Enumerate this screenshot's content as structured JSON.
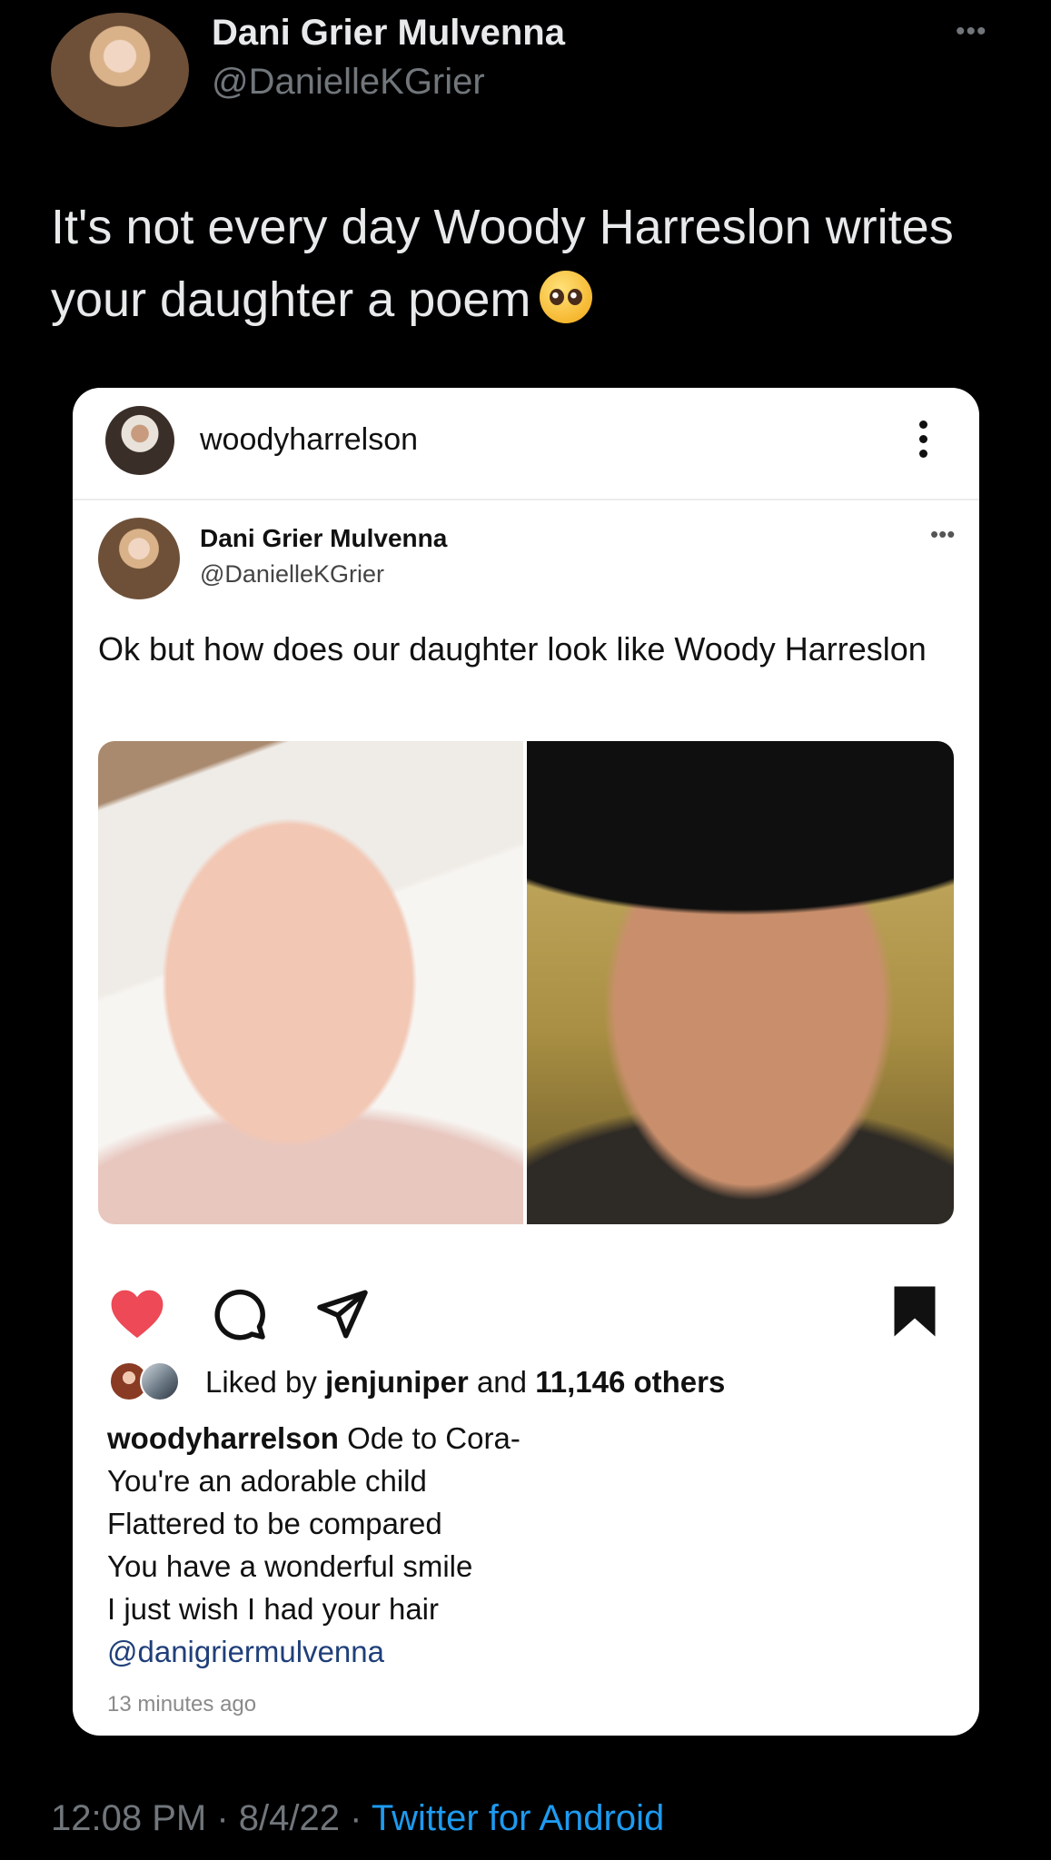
{
  "tweet": {
    "author_name": "Dani Grier Mulvenna",
    "author_handle": "@DanielleKGrier",
    "more_label": "•••",
    "text": "It's not every day Woody Harreslon writes your daughter a poem",
    "emoji": "pleading-face-emoji",
    "time": "12:08 PM",
    "date": "8/4/22",
    "separator": "·",
    "source": "Twitter for Android"
  },
  "instagram_post": {
    "username": "woodyharrelson",
    "embedded_tweet": {
      "author_name": "Dani Grier Mulvenna",
      "author_handle": "@DanielleKGrier",
      "more_label": "•••",
      "text": "Ok but how does our daughter look like Woody Harreslon"
    },
    "actions": {
      "like_icon": "heart-icon",
      "liked": true,
      "like_color": "#ed4956",
      "comment_icon": "comment-icon",
      "share_icon": "share-icon",
      "save_icon": "bookmark-icon"
    },
    "likes": {
      "prefix": "Liked by",
      "user": "jenjuniper",
      "middle": "and",
      "count_text": "11,146 others"
    },
    "caption": {
      "user": "woodyharrelson",
      "first_line": "Ode to Cora-",
      "lines": [
        "You're an adorable child",
        "Flattered to be compared",
        "You have a wonderful smile",
        "I just wish I had your hair"
      ],
      "mention": "@danigriermulvenna"
    },
    "time_ago": "13 minutes ago"
  },
  "colors": {
    "background": "#000000",
    "link_blue": "#1d9bf0",
    "muted_gray": "#71767b"
  }
}
